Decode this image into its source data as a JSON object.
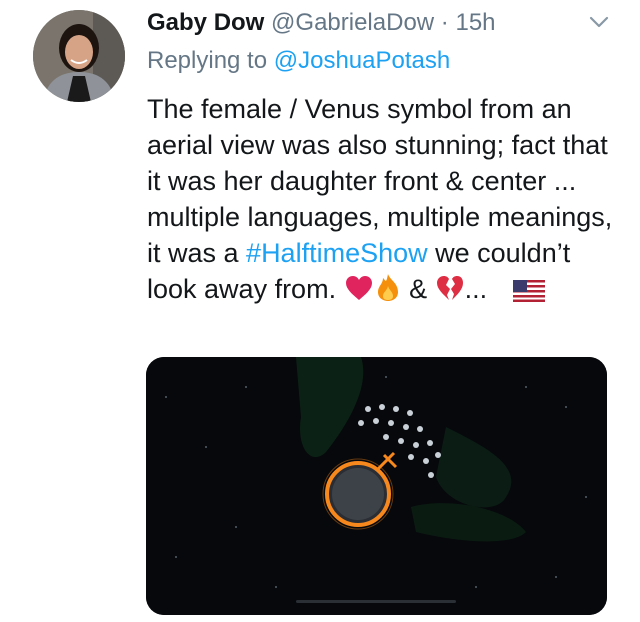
{
  "author": {
    "name": "Gaby Dow",
    "handle": "@GabrielaDow",
    "separator": "·",
    "time": "15h"
  },
  "reply": {
    "prefix": "Replying to",
    "mention": "@JoshuaPotash"
  },
  "tweet": {
    "text_before": "The female / Venus symbol from an aerial view was also stunning; fact that it was her daughter front & center ... multiple languages, multiple meanings, it was a ",
    "hashtag": "#HalftimeShow",
    "text_after": " we couldn’t look away from. ",
    "emoji_ampersand": " & ",
    "emoji_ellipsis": "... "
  },
  "icons": {
    "menu": "chevron-down-icon",
    "emojis": [
      "red-heart-icon",
      "fire-icon",
      "broken-heart-icon",
      "us-flag-icon"
    ]
  },
  "colors": {
    "link": "#1da1f2",
    "secondary": "#657786",
    "text": "#14171a",
    "heart": "#e0245e",
    "ring": "#f7881e"
  }
}
